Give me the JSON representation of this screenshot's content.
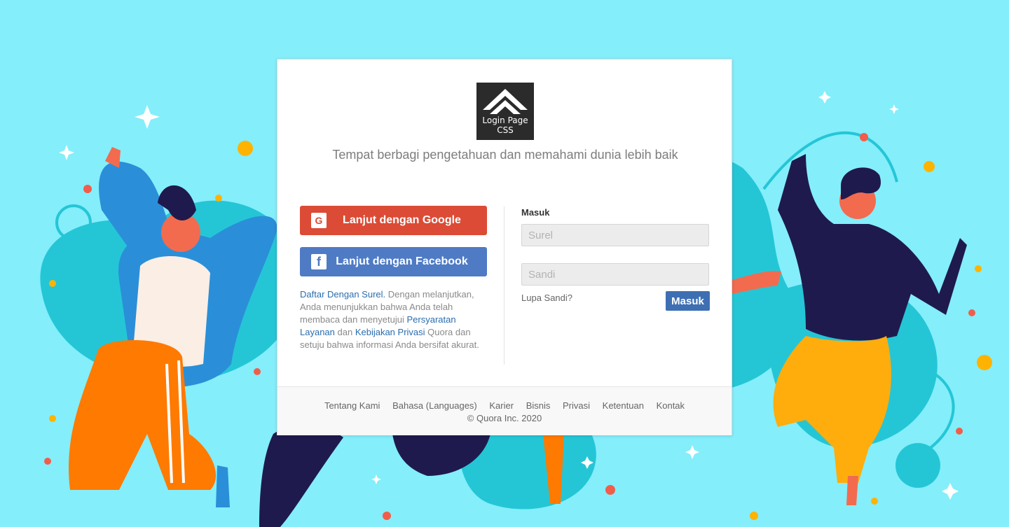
{
  "page": {
    "background_color": "#84eefb"
  },
  "logo": {
    "line1": "Login Page",
    "line2": "CSS"
  },
  "tagline": "Tempat berbagi pengetahuan dan memahami dunia lebih baik",
  "social": {
    "google": {
      "icon": "google-g-icon",
      "glyph": "G",
      "label": "Lanjut dengan Google",
      "color": "#dc4b35"
    },
    "facebook": {
      "icon": "facebook-icon",
      "glyph": "f",
      "label": "Lanjut dengan Facebook",
      "color": "#4f7bc5"
    }
  },
  "legal": {
    "signup_link": "Daftar Dengan Surel.",
    "text1": " Dengan melanjutkan, Anda menunjukkan bahwa Anda telah membaca dan menyetujui ",
    "terms_link": "Persyaratan Layanan",
    "text2": " dan ",
    "privacy_link": "Kebijakan Privasi",
    "text3": " Quora dan setuju bahwa informasi Anda bersifat akurat."
  },
  "login": {
    "title": "Masuk",
    "email_placeholder": "Surel",
    "password_placeholder": "Sandi",
    "forgot": "Lupa Sandi?",
    "submit": "Masuk"
  },
  "footer": {
    "links": [
      "Tentang Kami",
      "Bahasa (Languages)",
      "Karier",
      "Bisnis",
      "Privasi",
      "Ketentuan",
      "Kontak"
    ],
    "copyright": "© Quora Inc. 2020"
  }
}
